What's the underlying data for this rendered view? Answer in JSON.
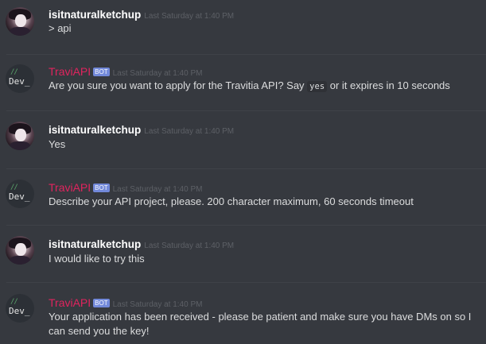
{
  "user_name": "isitnaturalketchup",
  "bot_name": "TraviAPI",
  "bot_tag": "BOT",
  "bot_avatar": {
    "slashes": "//",
    "text": "Dev_"
  },
  "timestamp": "Last Saturday at 1:40 PM",
  "colors": {
    "background": "#36393f",
    "bot_name": "#e0245e",
    "bot_tag": "#7289da",
    "text": "#dcddde",
    "timestamp": "#5d6066"
  },
  "messages": [
    {
      "author": "user",
      "text": "> api"
    },
    {
      "author": "bot",
      "text_before": "Are you sure you want to apply for the Travitia API? Say ",
      "code": "yes",
      "text_after": " or it expires in 10 seconds"
    },
    {
      "author": "user",
      "text": "Yes"
    },
    {
      "author": "bot",
      "text": "Describe your API project, please. 200 character maximum, 60 seconds timeout"
    },
    {
      "author": "user",
      "text": "I would like to try this"
    },
    {
      "author": "bot",
      "text": "Your application has been received - please be patient and make sure you have DMs on so I can send you the key!"
    }
  ]
}
